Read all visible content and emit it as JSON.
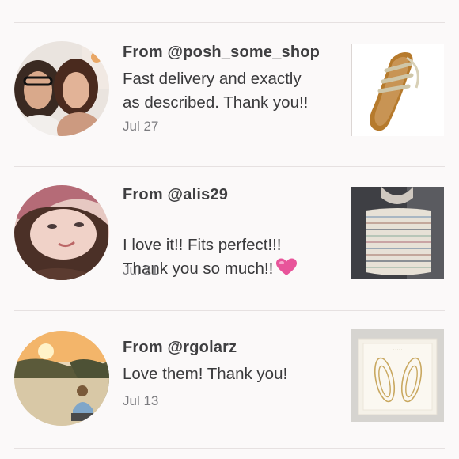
{
  "reviews": [
    {
      "from": "From @posh_some_shop",
      "message": "Fast delivery and exactly\nas described. Thank you!!",
      "date": "Jul 27",
      "avatar_icon": "user-photo-two-women",
      "item_icon": "strappy-sandal"
    },
    {
      "from": "From @alis29",
      "message": "I love it!! Fits perfect!!!\nThank you so much!!",
      "emoji": "pink-heart",
      "date": "Jul 21",
      "avatar_icon": "user-photo-woman-selfie",
      "item_icon": "striped-tube-top"
    },
    {
      "from": "From @rgolarz",
      "message": "Love them! Thank you!",
      "date": "Jul 13",
      "avatar_icon": "user-photo-beach-sunset",
      "item_icon": "gold-hoop-earrings"
    }
  ],
  "colors": {
    "background": "#fbf9f9",
    "divider": "#e6e1e1",
    "heart": "#e8549a"
  }
}
